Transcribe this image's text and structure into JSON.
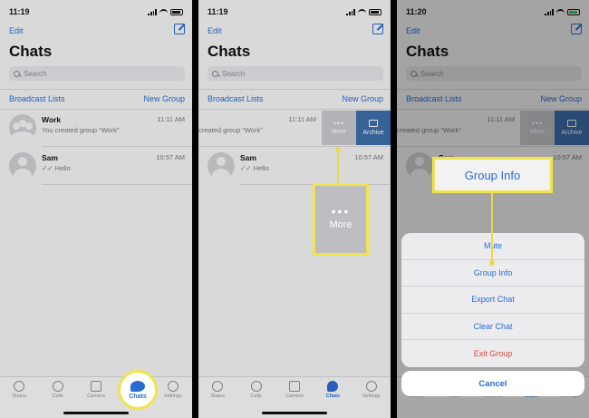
{
  "status_times": [
    "11:19",
    "11:19",
    "11:20"
  ],
  "nav": {
    "edit_label": "Edit",
    "title": "Chats"
  },
  "search": {
    "placeholder": "Search"
  },
  "links": {
    "broadcast": "Broadcast Lists",
    "new_group": "New Group"
  },
  "chats": [
    {
      "name": "Work",
      "message": "You created group “Work”",
      "time": "11:11 AM",
      "avatar": "group-avatar-icon"
    },
    {
      "name": "Sam",
      "message": "✓✓ Hello",
      "time": "10:57 AM",
      "avatar": "person-avatar-icon"
    }
  ],
  "swiped_row": {
    "message_fragment": "created group “Work”",
    "time": "11:11 AM"
  },
  "swipe_actions": {
    "more": "More",
    "archive": "Archive"
  },
  "tabs": [
    "Status",
    "Calls",
    "Camera",
    "Chats",
    "Settings"
  ],
  "callouts": {
    "more": "More",
    "group_info": "Group Info"
  },
  "action_sheet": {
    "items": [
      "Mute",
      "Group Info",
      "Export Chat",
      "Clear Chat",
      "Exit Group"
    ],
    "cancel": "Cancel"
  },
  "colors": {
    "accent": "#2a6bd1",
    "archive": "#3d6ea9",
    "highlight": "#f1e34b",
    "danger": "#d9453a"
  }
}
